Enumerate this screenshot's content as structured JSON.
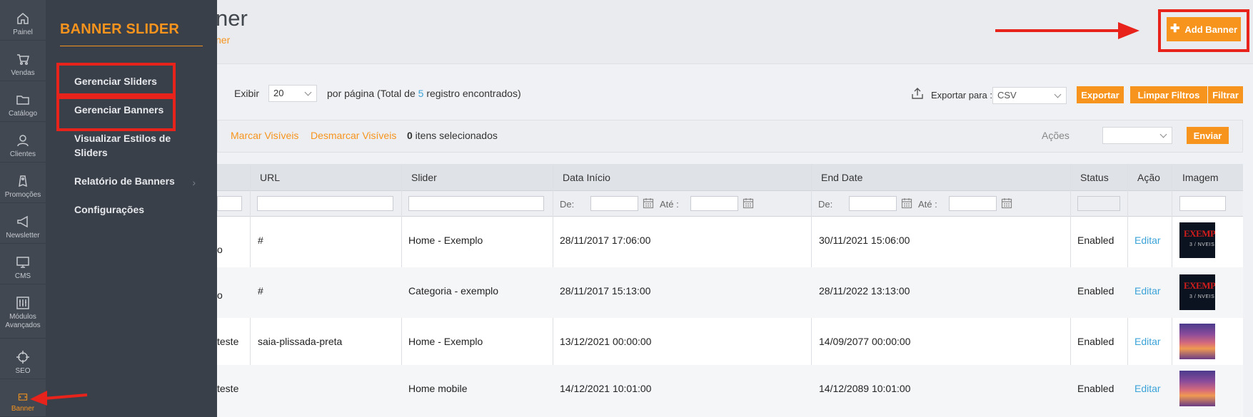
{
  "rail": [
    {
      "name": "painel",
      "icon": "home-icon",
      "label": "Painel"
    },
    {
      "name": "vendas",
      "icon": "cart-icon",
      "label": "Vendas"
    },
    {
      "name": "catalogo",
      "icon": "folder-icon",
      "label": "Catálogo"
    },
    {
      "name": "clientes",
      "icon": "user-icon",
      "label": "Clientes"
    },
    {
      "name": "promocoes",
      "icon": "tag-icon",
      "label": "Promoções"
    },
    {
      "name": "newsletter",
      "icon": "megaphone-icon",
      "label": "Newsletter"
    },
    {
      "name": "cms",
      "icon": "monitor-icon",
      "label": "CMS"
    },
    {
      "name": "modulos",
      "icon": "sliders-icon",
      "label": "Módulos Avançados"
    },
    {
      "name": "seo",
      "icon": "crosshair-icon",
      "label": "SEO"
    },
    {
      "name": "banner",
      "icon": "banner-icon",
      "label": "Banner",
      "active": true
    }
  ],
  "flyout": {
    "title": "BANNER SLIDER",
    "items": [
      {
        "label": "Gerenciar Sliders"
      },
      {
        "label": "Gerenciar Banners"
      },
      {
        "label": "Visualizar Estilos de Sliders"
      },
      {
        "label": "Relatório de Banners",
        "has_submenu": true
      },
      {
        "label": "Configurações"
      }
    ]
  },
  "header": {
    "title_visible": "ner",
    "breadcrumb_visible": "ner",
    "add_button": "Add Banner"
  },
  "toolbar": {
    "show_label": "Exibir",
    "per_page_value": "20",
    "per_page_text_before": "por página (Total de ",
    "total": "5",
    "per_page_text_after": " registro encontrados)",
    "export_label": "Exportar para :",
    "export_format": "CSV",
    "export_button": "Exportar",
    "clear_filters_button": "Limpar Filtros",
    "filter_button": "Filtrar"
  },
  "massaction": {
    "mark_visible": "Marcar Visíveis",
    "unmark_visible": "Desmarcar Visíveis",
    "selected_count": "0",
    "selected_text": " itens selecionados",
    "actions_label": "Ações",
    "submit_button": "Enviar"
  },
  "grid": {
    "columns": [
      "URL",
      "Slider",
      "Data Início",
      "End Date",
      "Status",
      "Ação",
      "Imagem"
    ],
    "filter": {
      "from": "De:",
      "to": "Até :"
    },
    "rows": [
      {
        "title_fragment": "o",
        "url": "#",
        "slider": "Home - Exemplo",
        "start": "28/11/2017 17:06:00",
        "end": "30/11/2021 15:06:00",
        "status": "Enabled",
        "action": "Editar",
        "image": "dark",
        "image_text_1": "EXEMPLO",
        "image_text_2": "3 / NVEIS"
      },
      {
        "title_fragment": "o",
        "url": "#",
        "slider": "Categoria - exemplo",
        "start": "28/11/2017 15:13:00",
        "end": "28/11/2022 13:13:00",
        "status": "Enabled",
        "action": "Editar",
        "image": "dark",
        "image_text_1": "EXEMPLO",
        "image_text_2": "3 / NVEIS"
      },
      {
        "title_fragment": "teste",
        "url": "saia-plissada-preta",
        "slider": "Home - Exemplo",
        "start": "13/12/2021 00:00:00",
        "end": "14/09/2077 00:00:00",
        "status": "Enabled",
        "action": "Editar",
        "image": "sunset"
      },
      {
        "title_fragment": "teste",
        "url": "",
        "slider": "Home mobile",
        "start": "14/12/2021 10:01:00",
        "end": "14/12/2089 10:01:00",
        "status": "Enabled",
        "action": "Editar",
        "image": "sunset"
      }
    ]
  },
  "colors": {
    "accent": "#f7941d",
    "rail_bg": "#414852",
    "flyout_bg": "#3a404a",
    "annotation": "#e8231b",
    "link": "#3ba3d8"
  }
}
